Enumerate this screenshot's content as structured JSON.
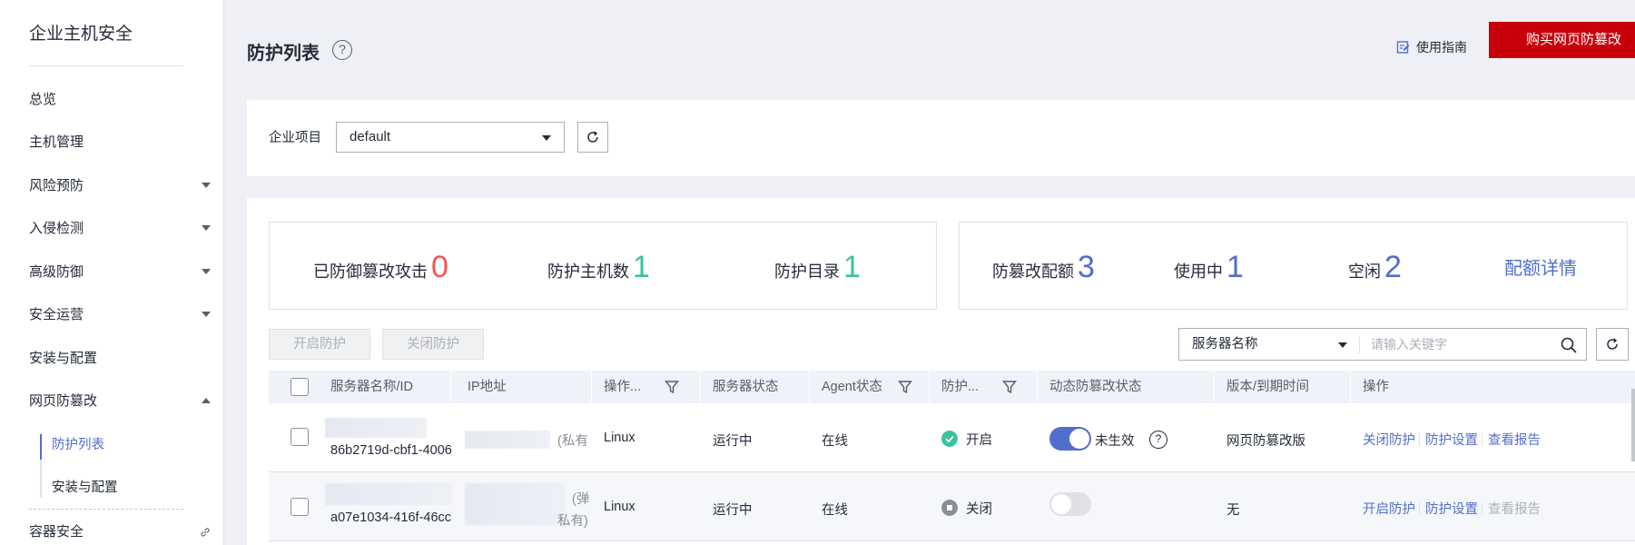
{
  "sidebar": {
    "title": "企业主机安全",
    "items": [
      {
        "label": "总览"
      },
      {
        "label": "主机管理"
      },
      {
        "label": "风险预防"
      },
      {
        "label": "入侵检测"
      },
      {
        "label": "高级防御"
      },
      {
        "label": "安全运营"
      },
      {
        "label": "安装与配置"
      },
      {
        "label": "网页防篡改"
      },
      {
        "label": "容器安全"
      }
    ],
    "sub_items": [
      {
        "label": "防护列表"
      },
      {
        "label": "安装与配置"
      }
    ]
  },
  "header": {
    "title": "防护列表",
    "guide_label": "使用指南",
    "buy_label": "购买网页防篡改"
  },
  "project": {
    "label": "企业项目",
    "value": "default"
  },
  "stats": {
    "blocked_label": "已防御篡改攻击",
    "blocked_value": "0",
    "hosts_label": "防护主机数",
    "hosts_value": "1",
    "dirs_label": "防护目录",
    "dirs_value": "1",
    "quota_label": "防篡改配额",
    "quota_value": "3",
    "in_use_label": "使用中",
    "in_use_value": "1",
    "idle_label": "空闲",
    "idle_value": "2",
    "quota_detail": "配额详情"
  },
  "actions": {
    "enable": "开启防护",
    "disable": "关闭防护"
  },
  "search": {
    "field": "服务器名称",
    "placeholder": "请输入关键字"
  },
  "table": {
    "columns": {
      "name": "服务器名称/ID",
      "ip": "IP地址",
      "os": "操作...",
      "server_status": "服务器状态",
      "agent_status": "Agent状态",
      "protect": "防护...",
      "dynamic": "动态防篡改状态",
      "version": "版本/到期时间",
      "ops": "操作"
    },
    "rows": [
      {
        "id": "86b2719d-cbf1-4006",
        "ip_tag": "(私有",
        "os": "Linux",
        "server_status": "运行中",
        "agent_status": "在线",
        "protect": "开启",
        "dynamic": "未生效",
        "version": "网页防篡改版",
        "op1": "关闭防护",
        "op2": "防护设置",
        "op3": "查看报告"
      },
      {
        "id": "a07e1034-416f-46cc",
        "ip_tag1": "(弹",
        "ip_tag2": "私有)",
        "os": "Linux",
        "server_status": "运行中",
        "agent_status": "在线",
        "protect": "关闭",
        "dynamic": "",
        "version": "无",
        "op1": "开启防护",
        "op2": "防护设置",
        "op3": "查看报告"
      }
    ]
  },
  "colors": {
    "brand_red": "#c7000b",
    "link_blue": "#526ecc",
    "stat_red": "#f15451",
    "stat_green": "#3ac29f",
    "status_green": "#3ac29f",
    "status_gray": "#8a8e99"
  }
}
